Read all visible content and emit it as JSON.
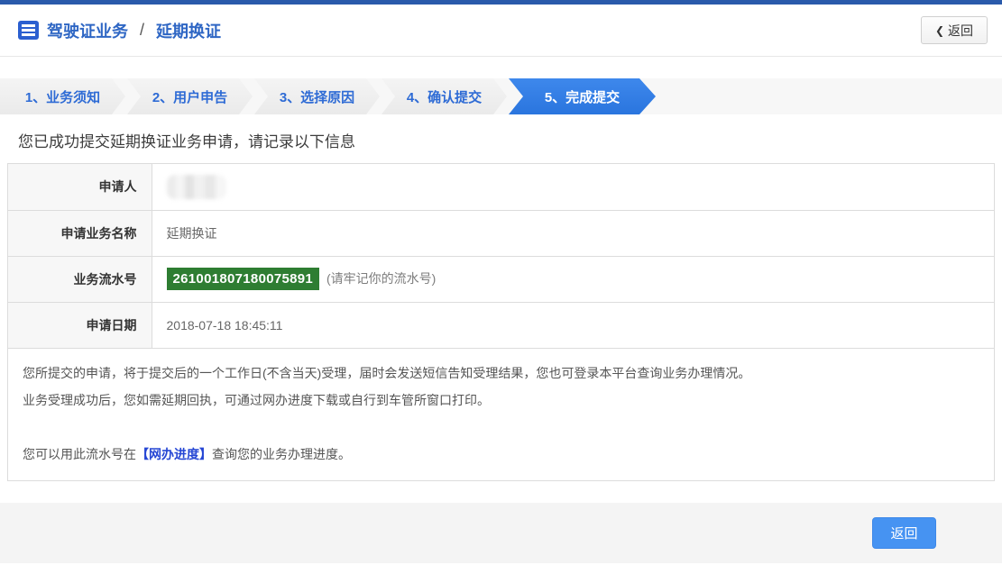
{
  "header": {
    "breadcrumb_primary": "驾驶证业务",
    "breadcrumb_separator": "/",
    "breadcrumb_secondary": "延期换证",
    "back_button_label": "返回",
    "back_chevron": "❮"
  },
  "steps": [
    {
      "label": "1、业务须知",
      "active": false
    },
    {
      "label": "2、用户申告",
      "active": false
    },
    {
      "label": "3、选择原因",
      "active": false
    },
    {
      "label": "4、确认提交",
      "active": false
    },
    {
      "label": "5、完成提交",
      "active": true
    }
  ],
  "main": {
    "success_message": "您已成功提交延期换证业务申请，请记录以下信息",
    "table": {
      "rows": [
        {
          "label": "申请人",
          "value": "",
          "redacted": true
        },
        {
          "label": "申请业务名称",
          "value": "延期换证"
        },
        {
          "label": "业务流水号",
          "value": "261001807180075891",
          "note": "(请牢记你的流水号)"
        },
        {
          "label": "申请日期",
          "value": "2018-07-18 18:45:11"
        }
      ]
    },
    "notes": {
      "line1": "您所提交的申请，将于提交后的一个工作日(不含当天)受理，届时会发送短信告知受理结果，您也可登录本平台查询业务办理情况。",
      "line2": "业务受理成功后，您如需延期回执，可通过网办进度下载或自行到车管所窗口打印。",
      "progress_prefix": "您可以用此流水号在",
      "progress_link": "【网办进度】",
      "progress_suffix": "查询您的业务办理进度。"
    }
  },
  "footer": {
    "back_button_label": "返回"
  },
  "colors": {
    "top_strip": "#2a5aab",
    "title_blue": "#2e66c4",
    "step_text_blue": "#2e6bd5",
    "active_step_blue": "#2b7ce4",
    "serial_badge_green": "#2e7d32",
    "footer_button_blue": "#4693f2",
    "progress_link_blue": "#2546d4"
  }
}
